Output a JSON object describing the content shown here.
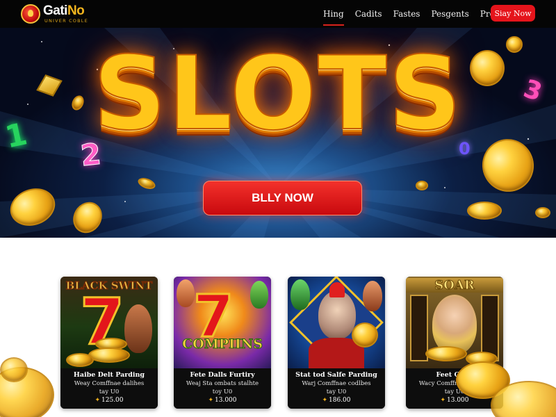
{
  "brand": {
    "name_main": "Gati",
    "name_accent": "No",
    "tagline": "UNIVER COBLE"
  },
  "nav": {
    "links": [
      {
        "label": "Hing",
        "active": true
      },
      {
        "label": "Cadits",
        "active": false
      },
      {
        "label": "Fastes",
        "active": false
      },
      {
        "label": "Pesgents",
        "active": false
      },
      {
        "label": "Preduct",
        "active": false
      }
    ],
    "cta_label": "Siay Now"
  },
  "hero": {
    "title": "SLOTS",
    "cta_label": "BLLY NOW",
    "floating_digits": [
      "1",
      "2",
      "3",
      "0"
    ]
  },
  "cards": [
    {
      "art_title": "BLACK SWINT",
      "title": "Haibe Delt Parding",
      "desc_line1": "Weay Comffnae dalihes",
      "desc_line2": "tay U0",
      "price": "125.00"
    },
    {
      "art_title": "COMPIINS",
      "title": "Fete Dalls Furtiry",
      "desc_line1": "Weaj Sta ombats stalhte",
      "desc_line2": "toy U0",
      "price": "13.000"
    },
    {
      "art_title": "",
      "title": "Stat tod Salfe Parding",
      "desc_line1": "Warj Comffnae codlbes",
      "desc_line2": "tay U0",
      "price": "186.00"
    },
    {
      "art_title": "SOAR",
      "title": "Feet Catis",
      "desc_line1": "Wacy Comffnae codihes",
      "desc_line2": "tay U0",
      "price": "13.000"
    }
  ],
  "colors": {
    "nav_bg": "#050505",
    "accent_red": "#e5141b",
    "gold": "#ffc61a",
    "hero_glow": "#3a86c9"
  }
}
